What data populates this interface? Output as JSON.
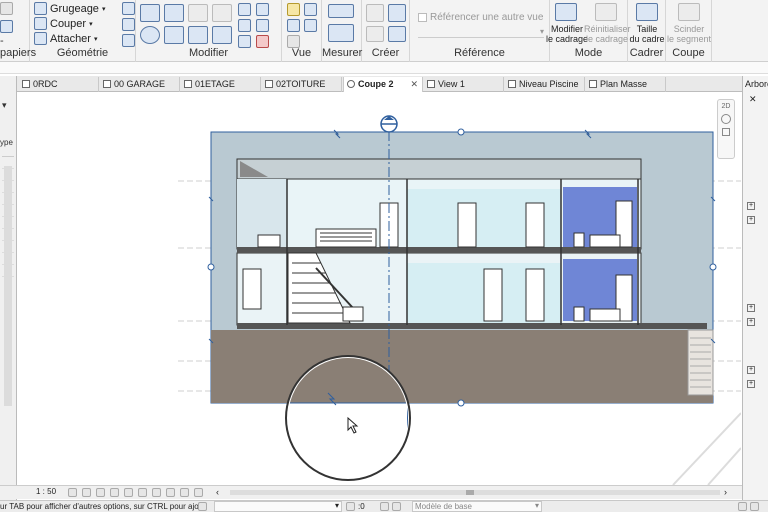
{
  "ribbon": {
    "clipboard_label": "-papiers",
    "geometry": {
      "title": "Géométrie",
      "trim_label": "Grugeage",
      "cut_label": "Couper",
      "join_label": "Attacher"
    },
    "modify_title": "Modifier",
    "view_title": "Vue",
    "measure_title": "Mesurer",
    "create_title": "Créer",
    "reference": {
      "title": "Référence",
      "checkbox_label": "Référencer une autre vue"
    },
    "mode": {
      "title": "Mode",
      "edit_crop_label1": "Modifier",
      "edit_crop_label2": "le cadrage",
      "reset_crop_label1": "Réinitialiser",
      "reset_crop_label2": "le cadrage"
    },
    "crop": {
      "title": "Cadrer",
      "size_label1": "Taille",
      "size_label2": "du cadre"
    },
    "section": {
      "title": "Coupe",
      "split_label1": "Scinder",
      "split_label2": "le segment"
    }
  },
  "tabs": [
    {
      "label": "0RDC"
    },
    {
      "label": "00 GARAGE"
    },
    {
      "label": "01ETAGE"
    },
    {
      "label": "02TOITURE"
    },
    {
      "label": "Coupe 2"
    },
    {
      "label": "View 1"
    },
    {
      "label": "Niveau Piscine"
    },
    {
      "label": "Plan Masse"
    }
  ],
  "right_panel": {
    "title": "Arbore"
  },
  "left_panel": {
    "label": "ype"
  },
  "viewcube": {
    "label": "2D"
  },
  "status": {
    "scale": "1 : 50",
    "zero_value": ":0"
  },
  "bottom": {
    "hint": "ur TAB pour afficher d'autres options, sur CTRL pour ajout",
    "model_label": "Modèle de base"
  },
  "colors": {
    "crop_region": "#9fb3bf",
    "crop_border": "#2f5f9e",
    "ground": "#8a7f75",
    "blue_room": "#6f86d6",
    "glass": "#d6eef3"
  }
}
